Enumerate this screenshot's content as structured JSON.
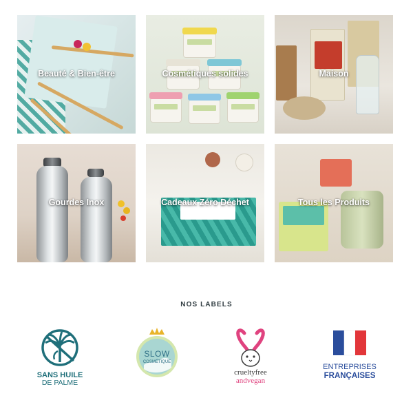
{
  "categories": [
    {
      "label": "Beauté & Bien-être"
    },
    {
      "label": "Cosmétiques solides"
    },
    {
      "label": "Maison"
    },
    {
      "label": "Gourdes Inox"
    },
    {
      "label": "Cadeaux Zéro Déchet"
    },
    {
      "label": "Tous les Produits"
    }
  ],
  "labels_section": {
    "title": "NOS LABELS",
    "logos": [
      {
        "icon": "palm-crossed-icon",
        "line1": "SANS HUILE",
        "line2": "DE PALME"
      },
      {
        "icon": "slow-cosmetique-icon",
        "line1": "SLOW",
        "line2": "COSMÉTIQUE"
      },
      {
        "icon": "bunny-icon",
        "line1": "crueltyfree",
        "line2": "andvegan"
      },
      {
        "icon": "french-flag-icon",
        "line1": "ENTREPRISES",
        "line2": "FRANÇAISES"
      }
    ]
  },
  "colors": {
    "teal": "#1f6f7a",
    "pink": "#e0437f",
    "french_blue": "#2a4d9c",
    "french_red": "#e2363a"
  }
}
